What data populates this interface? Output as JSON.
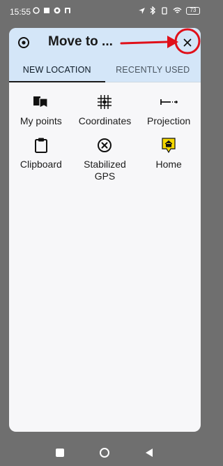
{
  "status_bar": {
    "time": "15:55",
    "battery": "73"
  },
  "dialog": {
    "title": "Move to ..."
  },
  "tabs": [
    {
      "label": "NEW LOCATION",
      "active": true
    },
    {
      "label": "RECENTLY USED",
      "active": false
    }
  ],
  "options": [
    {
      "label": "My points",
      "icon": "bookmarks-icon"
    },
    {
      "label": "Coordinates",
      "icon": "grid-icon"
    },
    {
      "label": "Projection",
      "icon": "projection-icon"
    },
    {
      "label": "Clipboard",
      "icon": "clipboard-icon"
    },
    {
      "label": "Stabilized\nGPS",
      "icon": "crosshair-circle-icon"
    },
    {
      "label": "Home",
      "icon": "home-marker-icon"
    }
  ],
  "colors": {
    "accent_annotation": "#e0101a",
    "header_bg": "#d4e6f8",
    "home_marker": "#f5d800"
  }
}
